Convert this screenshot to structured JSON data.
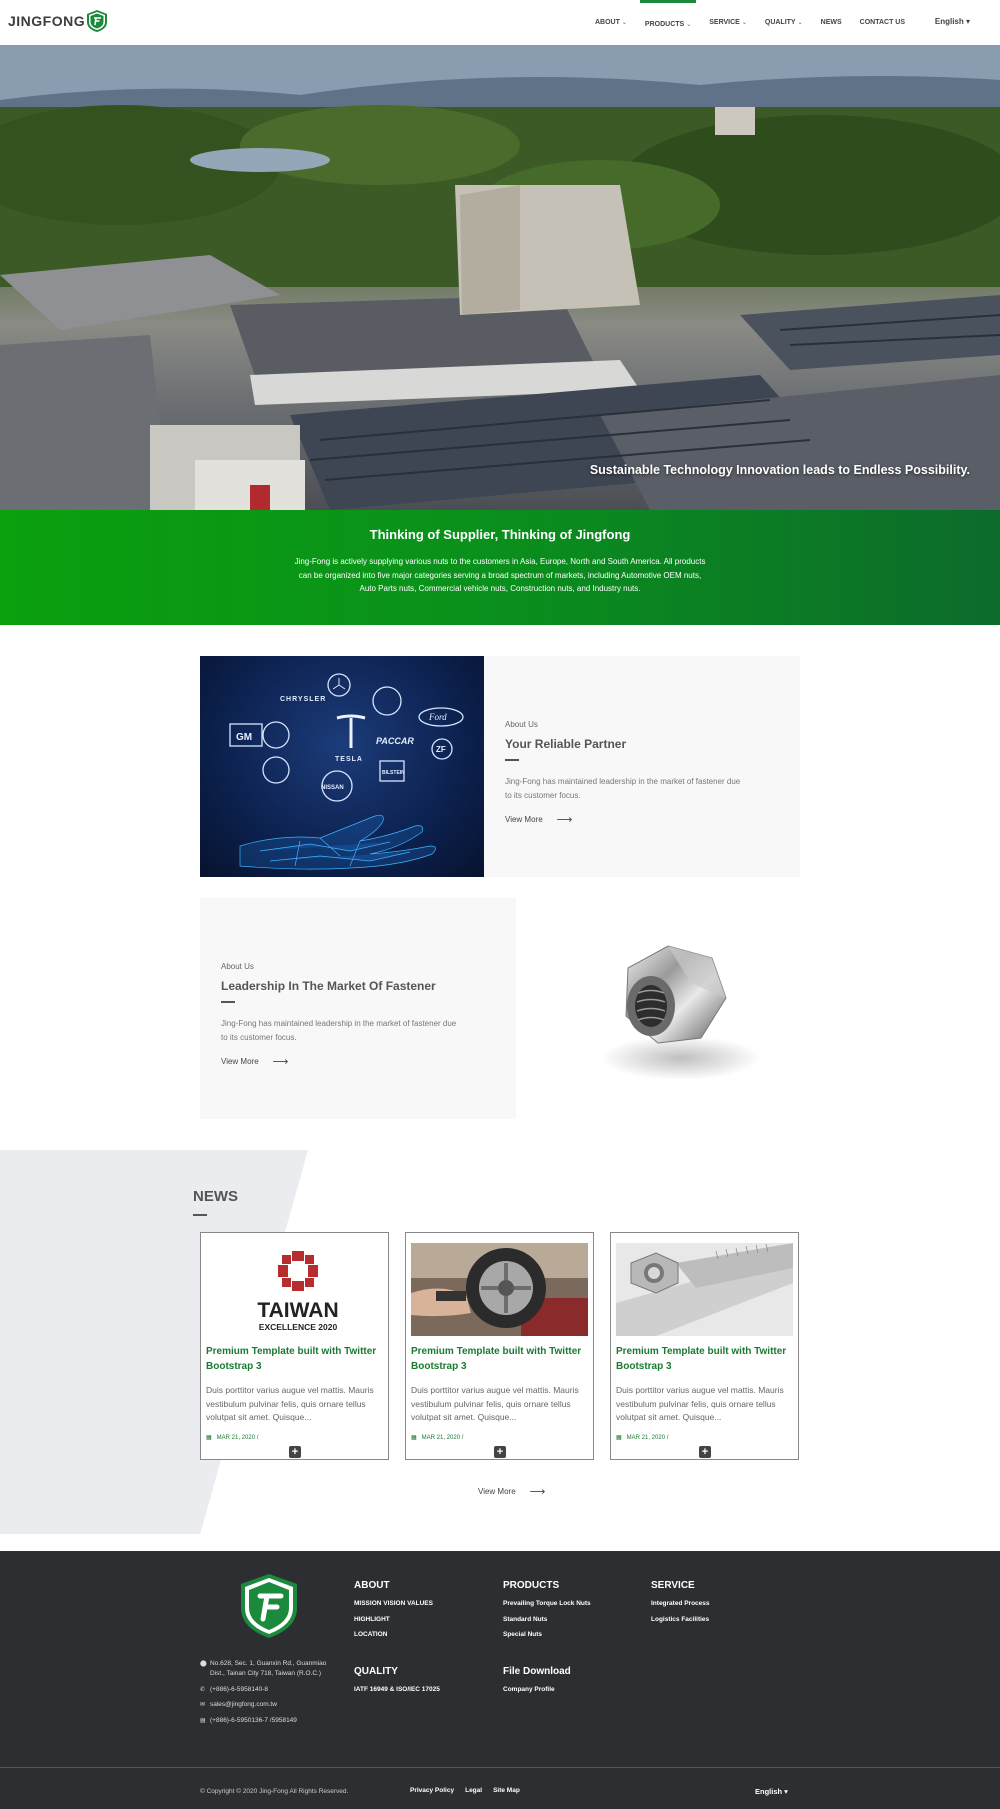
{
  "header": {
    "logo_text": "JINGFONG",
    "nav": [
      {
        "label": "ABOUT",
        "caret": "⌄"
      },
      {
        "label": "PRODUCTS",
        "caret": "⌄"
      },
      {
        "label": "SERVICE",
        "caret": "⌄"
      },
      {
        "label": "QUALITY",
        "caret": "⌄"
      },
      {
        "label": "NEWS",
        "caret": ""
      },
      {
        "label": "CONTACT US",
        "caret": ""
      }
    ],
    "language": "English ▾"
  },
  "hero": {
    "caption": "Sustainable Technology Innovation leads to Endless Possibility."
  },
  "intro": {
    "title": "Thinking of Supplier, Thinking of Jingfong",
    "text": "Jing-Fong is actively supplying various nuts to the customers in Asia, Europe, North and South America. All products can be organized into five major categories serving a broad spectrum of markets, including Automotive OEM nuts, Auto Parts nuts, Commercial vehicle nuts, Construction nuts, and Industry nuts."
  },
  "about_cards": [
    {
      "kicker": "About Us",
      "title": "Your Reliable Partner",
      "text": "Jing-Fong has maintained leadership in the market of fastener due to its customer focus.",
      "link": "View More",
      "brands": [
        "CHRYSLER",
        "GM",
        "TESLA",
        "PACCAR",
        "Ford",
        "NISSAN",
        "ZF",
        "BILSTEIN"
      ]
    },
    {
      "kicker": "About Us",
      "title": "Leadership In The Market Of Fastener",
      "text": "Jing-Fong has maintained leadership in the market of fastener due to its customer focus.",
      "link": "View More"
    }
  ],
  "news": {
    "heading": "NEWS",
    "items": [
      {
        "title": "Premium Template built with Twitter Bootstrap 3",
        "body": "Duis porttitor varius augue vel mattis. Mauris vestibulum pulvinar felis, quis ornare tellus volutpat sit amet. Quisque...",
        "date": "MAR 21, 2020 /",
        "thumb_title": "TAIWAN",
        "thumb_sub": "EXCELLENCE 2020"
      },
      {
        "title": "Premium Template built with Twitter Bootstrap 3",
        "body": "Duis porttitor varius augue vel mattis. Mauris vestibulum pulvinar felis, quis ornare tellus volutpat sit amet. Quisque...",
        "date": "MAR 21, 2020 /"
      },
      {
        "title": "Premium Template built with Twitter Bootstrap 3",
        "body": "Duis porttitor varius augue vel mattis. Mauris vestibulum pulvinar felis, quis ornare tellus volutpat sit amet. Quisque...",
        "date": "MAR 21, 2020 /"
      }
    ],
    "more_label": "View More"
  },
  "footer": {
    "contact": {
      "address": "No.628, Sec. 1, Guanxin Rd., Guanmiao Dist., Tainan City 718, Taiwan (R.O.C.)",
      "phone": "(+886)-6-5958140-8",
      "email": "sales@jingfong.com.tw",
      "fax": "(+886)-6-5950136-7 /5958149"
    },
    "about": {
      "heading": "ABOUT",
      "links": [
        "MISSION VISION VALUES",
        "HIGHLIGHT",
        "LOCATION"
      ]
    },
    "products": {
      "heading": "PRODUCTS",
      "links": [
        "Prevailing Torque Lock Nuts",
        "Standard Nuts",
        "Special Nuts"
      ]
    },
    "service": {
      "heading": "SERVICE",
      "links": [
        "Integrated Process",
        "Logistics Facilities"
      ]
    },
    "quality": {
      "heading": "QUALITY",
      "links": [
        "IATF 16949 & ISO/IEC 17025"
      ]
    },
    "download": {
      "heading": "File Download",
      "links": [
        "Company Profile"
      ]
    },
    "copyright": "© Copyright © 2020 Jing-Fong All Rights Reserved.",
    "bottom_links": [
      "Privacy Policy",
      "Legal",
      "Site Map"
    ],
    "language": "English ▾"
  }
}
